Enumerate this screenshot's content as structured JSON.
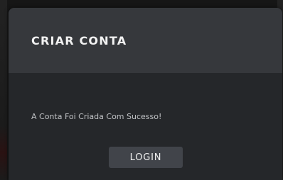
{
  "modal": {
    "title": "CRIAR CONTA",
    "message": "A Conta Foi Criada Com Sucesso!",
    "login_label": "LOGIN"
  },
  "colors": {
    "header_bg": "#36383c",
    "body_bg": "#25272a",
    "button_bg": "#41444a",
    "title_text": "#f2f2f2",
    "message_text": "#bfc1c4"
  }
}
